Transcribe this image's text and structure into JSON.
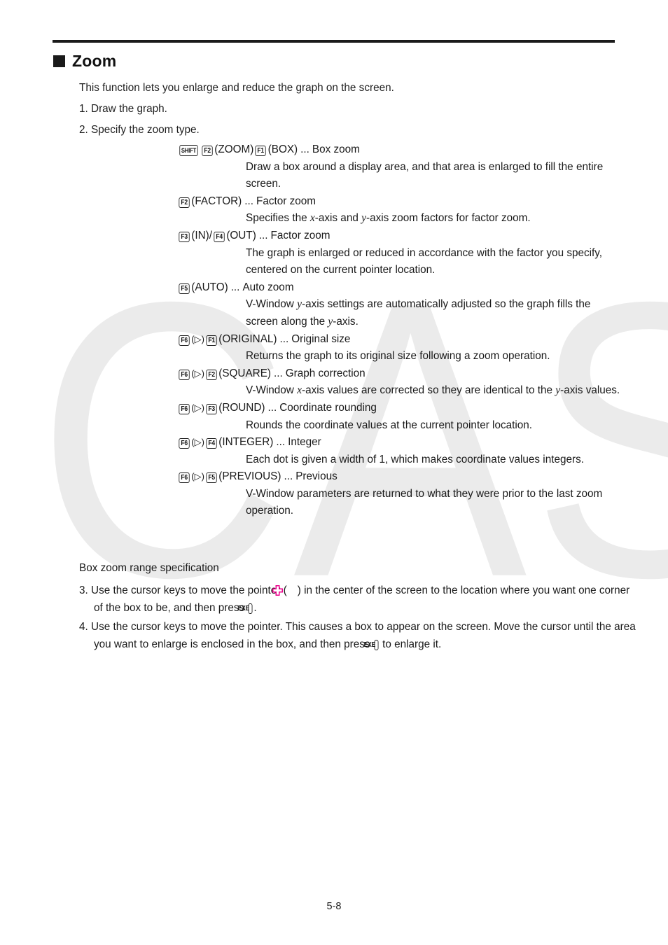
{
  "page": {
    "heading": "Zoom",
    "footer_page_number": "5-8",
    "watermark_text": "CASIO",
    "watermark_color": "#ebebeb",
    "pointer_color": "#ec008c",
    "text_color": "#1f1f1f"
  },
  "intro": {
    "text": "This function lets you enlarge and reduce the graph on the screen."
  },
  "steps_top": [
    {
      "number": "1.",
      "text": "Draw the graph."
    },
    {
      "number": "2.",
      "text": "Specify the zoom type."
    }
  ],
  "specs": [
    {
      "keys": [
        "SHIFT",
        "F2"
      ],
      "key_label_1": "SHIFT",
      "key_label_2": "F2",
      "paren_1": "(ZOOM)",
      "key_label_3": "F1",
      "paren_2": "(BOX)",
      "dots": "...",
      "title": "Box zoom",
      "description": "Draw a box around a display area, and that area is enlarged to fill the entire screen."
    },
    {
      "key_label_1": "F2",
      "paren_1": "(FACTOR)",
      "dots": "...",
      "title": "Factor zoom",
      "description_pre": "Specifies the ",
      "italic_1": "x",
      "description_mid": "-axis and ",
      "italic_2": "y",
      "description_post": "-axis zoom factors for factor zoom."
    },
    {
      "key_label_1": "F3",
      "paren_1": "(IN)/",
      "key_label_2": "F4",
      "paren_2": "(OUT)",
      "dots": "...",
      "title": "Factor zoom",
      "description": "The graph is enlarged or reduced in accordance with the factor you specify, centered on the current pointer location."
    },
    {
      "key_label_1": "F5",
      "paren_1": "(AUTO)",
      "dots": "...",
      "title": "Auto zoom",
      "description_pre": "V-Window ",
      "italic_1": "y",
      "description_mid": "-axis settings are automatically adjusted so the graph fills the screen along the ",
      "italic_2": "y",
      "description_post": "-axis."
    },
    {
      "key_label_1": "F6",
      "arrow": "(▷)",
      "key_label_2": "F1",
      "paren_2": "(ORIGINAL)",
      "dots": "...",
      "title": "Original size",
      "description": "Returns the graph to its original size following a zoom operation."
    },
    {
      "key_label_1": "F6",
      "arrow": "(▷)",
      "key_label_2": "F2",
      "paren_2": "(SQUARE)",
      "dots": "...",
      "title": "Graph correction",
      "description_pre": "V-Window ",
      "italic_1": "x",
      "description_mid": "-axis values are corrected so they are identical to the ",
      "italic_2": "y",
      "description_post": "-axis values."
    },
    {
      "key_label_1": "F6",
      "arrow": "(▷)",
      "key_label_2": "F3",
      "paren_2": "(ROUND)",
      "dots": "...",
      "title": "Coordinate rounding",
      "description": "Rounds the coordinate values at the current pointer location."
    },
    {
      "key_label_1": "F6",
      "arrow": "(▷)",
      "key_label_2": "F4",
      "paren_2": "(INTEGER)",
      "dots": "...",
      "title": "Integer",
      "description": "Each dot is given a width of 1, which makes coordinate values integers."
    },
    {
      "key_label_1": "F6",
      "arrow": "(▷)",
      "key_label_2": "F5",
      "paren_2": "(PREVIOUS)",
      "dots": "...",
      "title": "Previous",
      "description": "V-Window parameters are returned to what they were prior to the last zoom operation."
    }
  ],
  "box_zoom_section": {
    "subheading": "Box zoom range specification",
    "step3": {
      "number": "3.",
      "part1": "Use the cursor keys to move the pointer (",
      "pointer_icon_name": "crosshair-pointer-icon",
      "part2": ") in the center of the screen to the location where you want one corner of the box to be, and then press ",
      "key_label": "EXE",
      "part3": "."
    },
    "step4": {
      "number": "4.",
      "part1": "Use the cursor keys to move the pointer. This causes a box to appear on the screen. Move the cursor until the area you want to enlarge is enclosed in the box, and then press ",
      "key_label": "EXE",
      "part2": " to enlarge it."
    }
  }
}
